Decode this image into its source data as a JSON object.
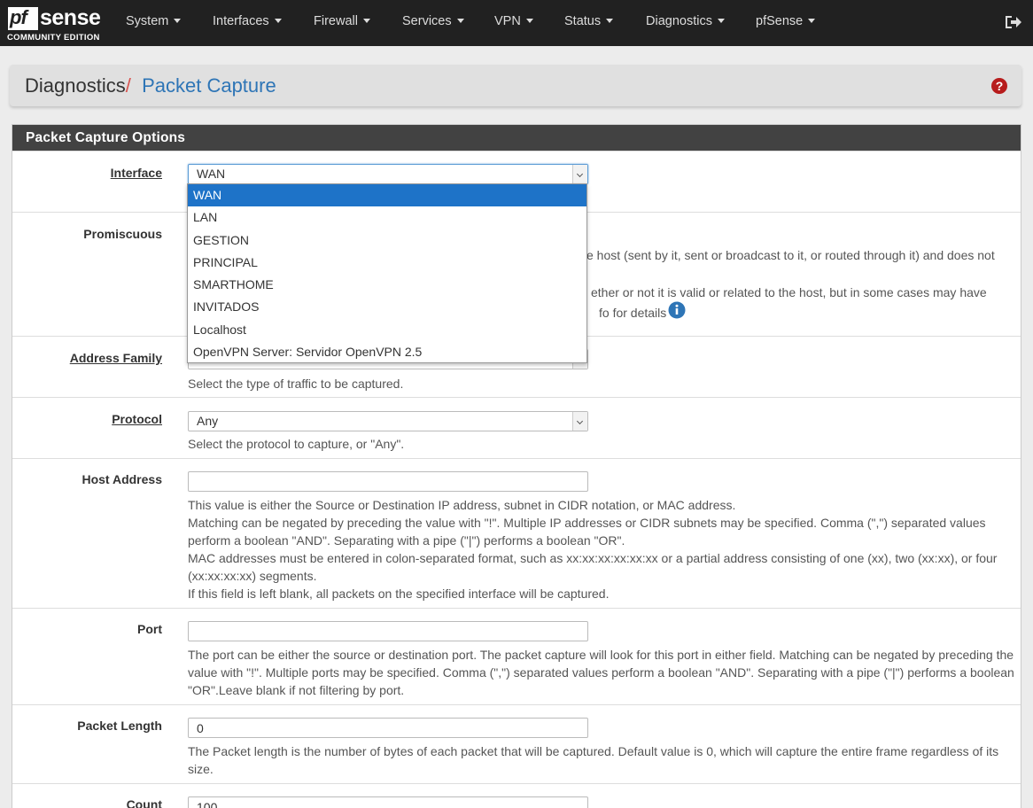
{
  "logo": {
    "pf": "pf",
    "sense": "sense",
    "subtitle": "COMMUNITY EDITION"
  },
  "nav": {
    "items": [
      "System",
      "Interfaces",
      "Firewall",
      "Services",
      "VPN",
      "Status",
      "Diagnostics",
      "pfSense"
    ]
  },
  "breadcrumb": {
    "root": "Diagnostics",
    "separator": "/",
    "current": "Packet Capture"
  },
  "panel": {
    "title": "Packet Capture Options"
  },
  "interface": {
    "label": "Interface",
    "value": "WAN",
    "options": [
      "WAN",
      "LAN",
      "GESTION",
      "PRINCIPAL",
      "SMARTHOME",
      "INVITADOS",
      "Localhost",
      "OpenVPN Server: Servidor OpenVPN 2.5"
    ],
    "selected_option": "WAN"
  },
  "promiscuous": {
    "label": "Promiscuous",
    "help_line1_visible": "e host (sent by it, sent or broadcast to it, or routed through it) and does not",
    "help_line2_visible": "ether or not it is valid or related to the host, but in some cases may have",
    "help_line3_visible": "fo for details"
  },
  "address_family": {
    "label": "Address Family",
    "help": "Select the type of traffic to be captured."
  },
  "protocol": {
    "label": "Protocol",
    "value": "Any",
    "help": "Select the protocol to capture, or \"Any\"."
  },
  "host_address": {
    "label": "Host Address",
    "value": "",
    "help1": "This value is either the Source or Destination IP address, subnet in CIDR notation, or MAC address.",
    "help2": "Matching can be negated by preceding the value with \"!\". Multiple IP addresses or CIDR subnets may be specified. Comma (\",\") separated values perform a boolean \"AND\". Separating with a pipe (\"|\") performs a boolean \"OR\".",
    "help3": "MAC addresses must be entered in colon-separated format, such as xx:xx:xx:xx:xx:xx or a partial address consisting of one (xx), two (xx:xx), or four (xx:xx:xx:xx) segments.",
    "help4": "If this field is left blank, all packets on the specified interface will be captured."
  },
  "port": {
    "label": "Port",
    "value": "",
    "help": "The port can be either the source or destination port. The packet capture will look for this port in either field. Matching can be negated by preceding the value with \"!\". Multiple ports may be specified. Comma (\",\") separated values perform a boolean \"AND\". Separating with a pipe (\"|\") performs a boolean \"OR\".Leave blank if not filtering by port."
  },
  "packet_length": {
    "label": "Packet Length",
    "value": "0",
    "help": "The Packet length is the number of bytes of each packet that will be captured. Default value is 0, which will capture the entire frame regardless of its size."
  },
  "count": {
    "label": "Count",
    "value": "100"
  },
  "colors": {
    "navbar": "#212121",
    "accent_blue": "#2e75b6",
    "separator_red": "#d9534f",
    "panel_heading": "#424242",
    "dropdown_selected": "#1e73c8",
    "help_icon": "#b71c1c"
  },
  "icons": {
    "logout": "sign-out-icon",
    "help": "question-circle-icon",
    "info": "info-circle-icon"
  }
}
